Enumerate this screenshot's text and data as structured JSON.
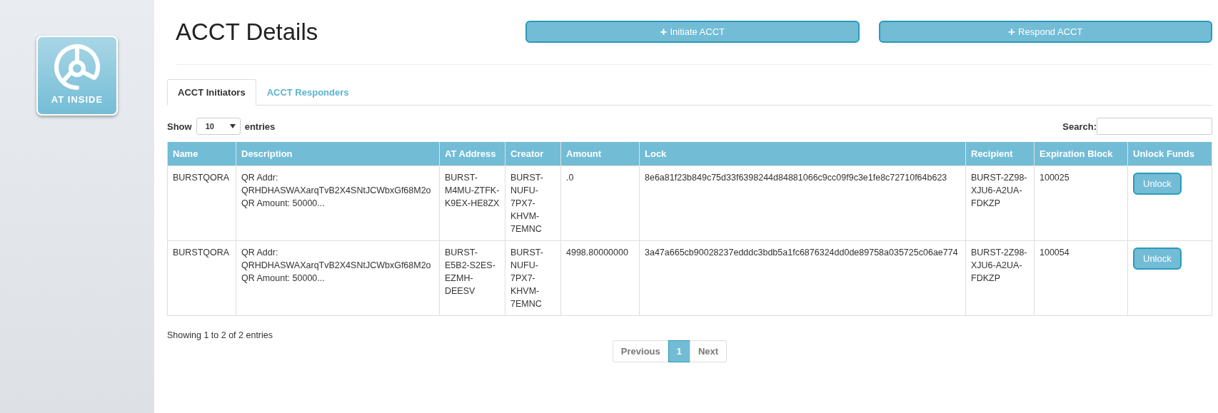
{
  "logo": {
    "label": "AT INSIDE"
  },
  "title": "ACCT Details",
  "actions": [
    {
      "label": "Initiate ACCT",
      "icon": "+"
    },
    {
      "label": "Respond ACCT",
      "icon": "+"
    }
  ],
  "tabs": [
    {
      "label": "ACCT Initiators",
      "selected": true
    },
    {
      "label": "ACCT Responders",
      "selected": false
    }
  ],
  "length_menu": {
    "before": "Show",
    "value": "10",
    "after": "entries"
  },
  "search": {
    "label": "Search:"
  },
  "table": {
    "columns": [
      "Name",
      "Description",
      "AT Address",
      "Creator",
      "Amount",
      "Lock",
      "Recipient",
      "Expiration Block",
      "Unlock Funds"
    ],
    "rows": [
      {
        "name": "BURSTQORA",
        "description": "QR Addr:\nQRHDHASWAXarqTvB2X4SNtJCWbxGf68M2o\nQR Amount: 50000...",
        "at_address": "BURST-M4MU-ZTFK-K9EX-HE8ZX",
        "creator": "BURST-NUFU-7PX7-KHVM-7EMNC",
        "amount": ".0",
        "lock": "8e6a81f23b849c75d33f6398244d84881066c9cc09f9c3e1fe8c72710f64b623",
        "recipient": "BURST-2Z98-XJU6-A2UA-FDKZP",
        "expiration_block": "100025",
        "action": "Unlock"
      },
      {
        "name": "BURSTQORA",
        "description": "QR Addr:\nQRHDHASWAXarqTvB2X4SNtJCWbxGf68M2o\nQR Amount: 50000...",
        "at_address": "BURST-E5B2-S2ES-EZMH-DEESV",
        "creator": "BURST-NUFU-7PX7-KHVM-7EMNC",
        "amount": "4998.80000000",
        "lock": "3a47a665cb90028237edddc3bdb5a1fc6876324dd0de89758a035725c06ae774",
        "recipient": "BURST-2Z98-XJU6-A2UA-FDKZP",
        "expiration_block": "100054",
        "action": "Unlock"
      }
    ]
  },
  "info": "Showing 1 to 2 of 2 entries",
  "pagination": [
    {
      "label": "Previous",
      "selected": false
    },
    {
      "label": "1",
      "selected": true
    },
    {
      "label": "Next",
      "selected": false
    }
  ]
}
